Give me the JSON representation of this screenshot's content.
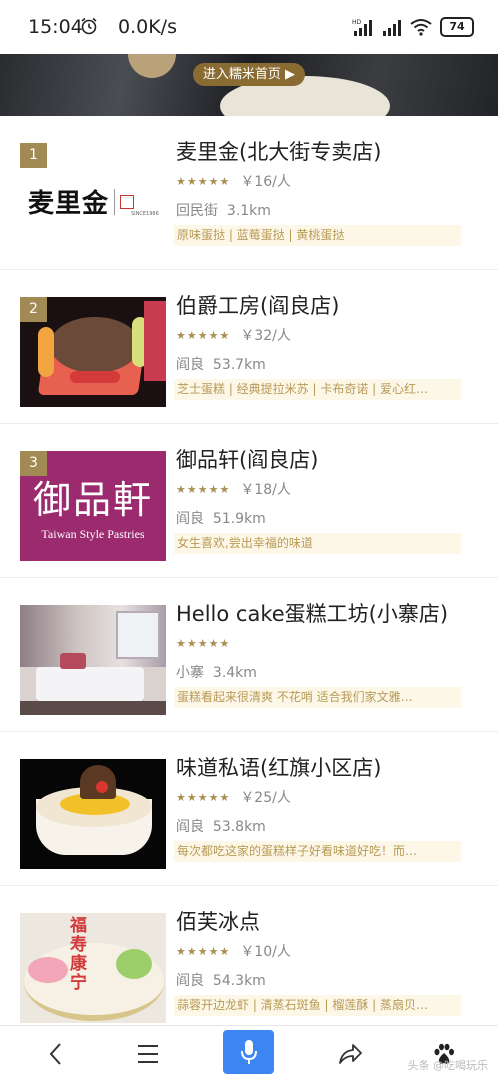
{
  "status_bar": {
    "time": "15:04",
    "network_speed": "0.0K/s",
    "battery": "74",
    "signal_label": "HD"
  },
  "banner": {
    "button_label": "进入糯米首页 ▶"
  },
  "shops": [
    {
      "rank": "1",
      "name": "麦里金(北大街专卖店)",
      "stars": "★★★★★",
      "price": "￥16/人",
      "area": "回民街",
      "distance": "3.1km",
      "tags": "原味蛋挞 | 蓝莓蛋挞 | 黄桃蛋挞",
      "image": {
        "logo_text": "麦里金",
        "logo_sub": "SINCE1986"
      }
    },
    {
      "rank": "2",
      "name": "伯爵工房(阎良店)",
      "stars": "★★★★★",
      "price": "￥32/人",
      "area": "阎良",
      "distance": "53.7km",
      "tags": "芝士蛋糕 | 经典提拉米苏 | 卡布奇诺 | 爱心红…",
      "image": {
        "kind": "fruit-cake"
      }
    },
    {
      "rank": "3",
      "name": "御品轩(阎良店)",
      "stars": "★★★★★",
      "price": "￥18/人",
      "area": "阎良",
      "distance": "51.9km",
      "tags": "女生喜欢,尝出幸福的味道",
      "image": {
        "logo_text": "御品軒",
        "logo_sub": "Taiwan Style Pastries"
      }
    },
    {
      "rank": "",
      "name": "Hello cake蛋糕工坊(小寨店)",
      "stars": "★★★★★",
      "price": "",
      "area": "小寨",
      "distance": "3.4km",
      "tags": "蛋糕看起来很清爽 不花哨 适合我们家文雅…",
      "image": {
        "kind": "room"
      }
    },
    {
      "rank": "",
      "name": "味道私语(红旗小区店)",
      "stars": "★★★★★",
      "price": "￥25/人",
      "area": "阎良",
      "distance": "53.8km",
      "tags": "每次都吃这家的蛋糕样子好看味道好吃！而…",
      "image": {
        "kind": "mango-cake"
      }
    },
    {
      "rank": "",
      "name": "佰芙冰点",
      "stars": "★★★★★",
      "price": "￥10/人",
      "area": "阎良",
      "distance": "54.3km",
      "tags": "蒜蓉开边龙虾 | 清蒸石斑鱼 | 榴莲酥 | 蒸扇贝…",
      "image": {
        "kind": "birthday-cake",
        "cake_text": "福寿康宁"
      }
    }
  ],
  "bottom_nav": {
    "watermark": "头条 @吃喝玩乐"
  },
  "colors": {
    "accent_gold": "#a28a55",
    "tag_text": "#b89a56",
    "tag_bg": "#fdf7e8",
    "mic_blue": "#3b86f0",
    "logo_red": "#9b2a6f"
  }
}
